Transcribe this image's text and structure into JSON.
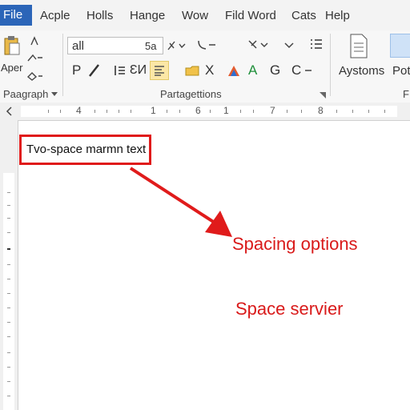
{
  "menu": {
    "file": "File",
    "items": [
      "Acple",
      "Holls",
      "Hange",
      "Wow",
      "Fild Word",
      "Cats",
      "Help"
    ]
  },
  "ribbon": {
    "clipboard": {
      "paste_label": "Aper",
      "group_label": "Paagraph"
    },
    "font": {
      "name": "all",
      "size": "5a"
    },
    "row2": [
      "P",
      "╱",
      "⏸",
      "ƐИ",
      "≡",
      "X",
      "A",
      "A",
      "G",
      "C"
    ],
    "group_label": "Partagettions",
    "styles_label": "Aystoms",
    "pot_label": "Pot",
    "group_right": "F"
  },
  "ruler": {
    "numbers": [
      "4",
      "1",
      "6",
      "1",
      "7",
      "8"
    ]
  },
  "document": {
    "textbox": "Tvo-space marmn text",
    "annotation1": "Spacing options",
    "annotation2": "Space servier"
  },
  "colors": {
    "accent": "#2b65b8",
    "annotation": "#d91a1a",
    "highlight": "#fce7a6"
  }
}
